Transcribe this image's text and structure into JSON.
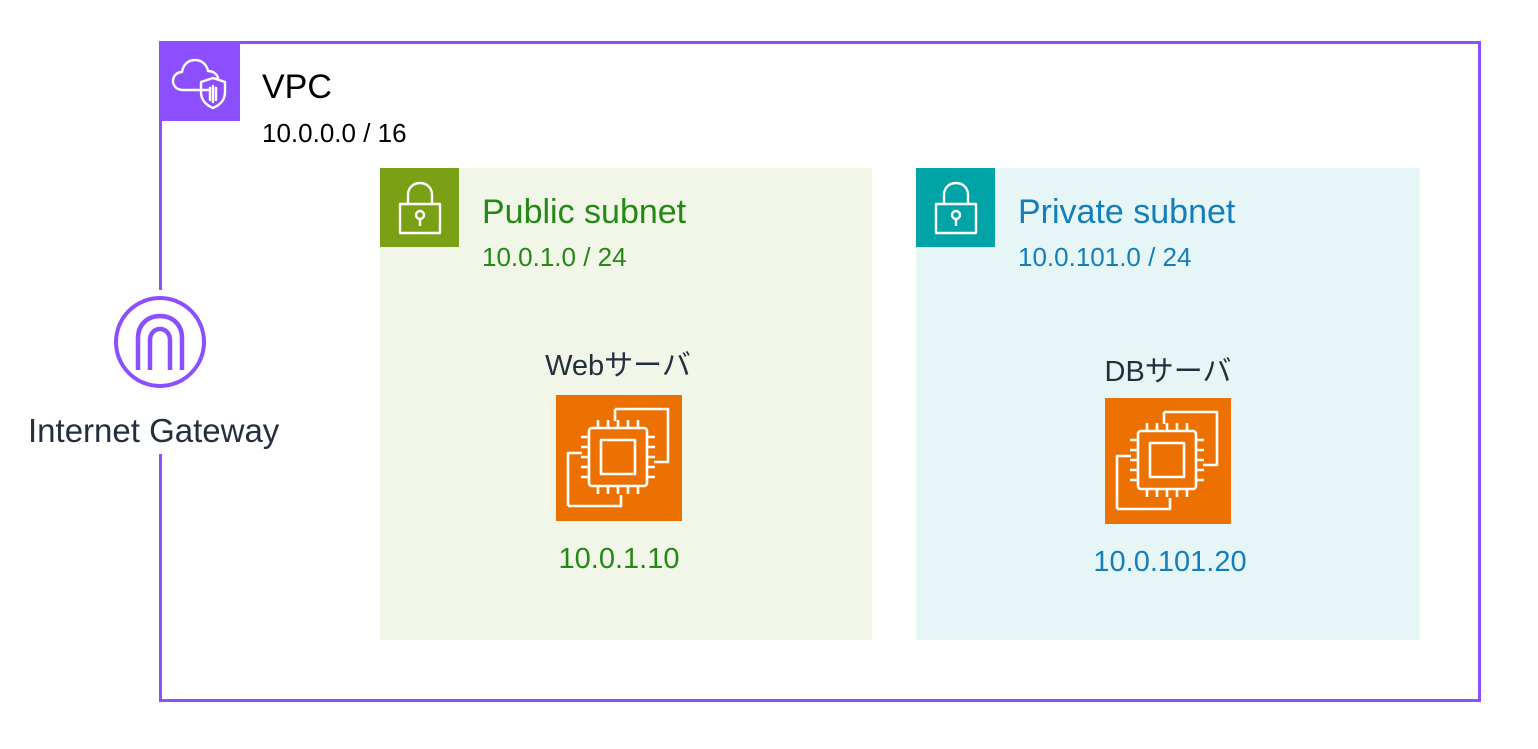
{
  "vpc": {
    "title": "VPC",
    "cidr": "10.0.0.0 / 16",
    "icon": "vpc-cloud-shield-icon",
    "color": "#8c4fff"
  },
  "internet_gateway": {
    "label": "Internet Gateway",
    "icon": "internet-gateway-icon",
    "color": "#8c4fff"
  },
  "public_subnet": {
    "title": "Public subnet",
    "cidr": "10.0.1.0 / 24",
    "icon": "lock-icon",
    "accent": "#7aa116",
    "text_color": "#248814",
    "background": "#f2f6e8",
    "server": {
      "label": "Webサーバ",
      "ip": "10.0.1.10",
      "icon": "ec2-instance-icon"
    }
  },
  "private_subnet": {
    "title": "Private subnet",
    "cidr": "10.0.101.0 / 24",
    "icon": "lock-icon",
    "accent": "#00a4a6",
    "text_color": "#147eba",
    "background": "#e6f6f7",
    "server": {
      "label": "DBサーバ",
      "ip": "10.0.101.20",
      "icon": "ec2-instance-icon"
    }
  }
}
